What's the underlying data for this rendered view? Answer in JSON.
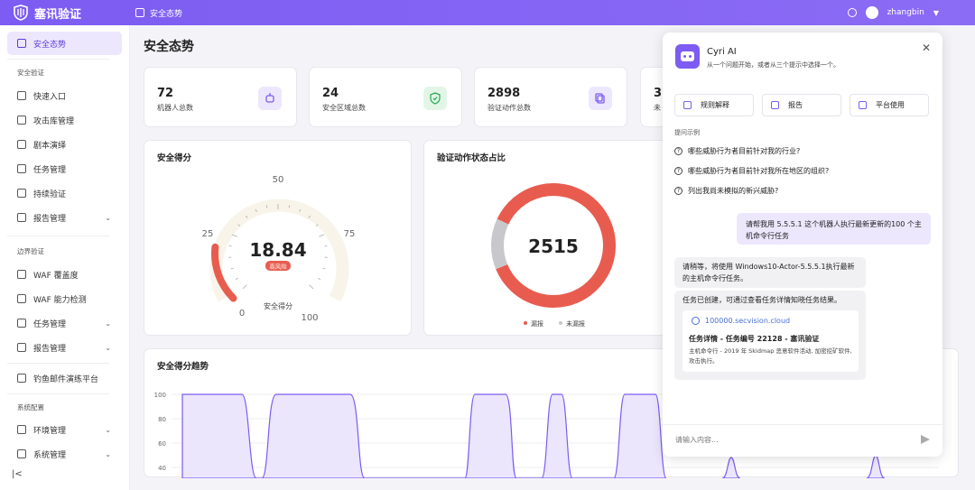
{
  "header": {
    "brand": "塞讯验证",
    "breadcrumb": "安全态势",
    "username": "zhangbin"
  },
  "sidebar": {
    "items_top": [
      {
        "label": "安全态势",
        "icon": "dashboard-icon"
      }
    ],
    "group1": "安全验证",
    "group1_items": [
      {
        "label": "快速入口",
        "icon": "entry-icon"
      },
      {
        "label": "攻击库管理",
        "icon": "attack-lib-icon"
      },
      {
        "label": "剧本演绎",
        "icon": "playbook-icon"
      },
      {
        "label": "任务管理",
        "icon": "task-icon"
      },
      {
        "label": "持续验证",
        "icon": "target-icon"
      },
      {
        "label": "报告管理",
        "icon": "report-icon"
      }
    ],
    "group2": "边界验证",
    "group2_items": [
      {
        "label": "WAF 覆盖度",
        "icon": "shield-icon"
      },
      {
        "label": "WAF 能力检测",
        "icon": "tool-icon"
      },
      {
        "label": "任务管理",
        "icon": "task-icon"
      },
      {
        "label": "报告管理",
        "icon": "report-icon"
      }
    ],
    "phishing": "钓鱼邮件演练平台",
    "group3": "系统配置",
    "group3_items": [
      {
        "label": "环境管理",
        "icon": "env-icon"
      },
      {
        "label": "系统管理",
        "icon": "settings-icon"
      }
    ]
  },
  "main": {
    "title": "安全态势",
    "stats": [
      {
        "value": "72",
        "label": "机器人总数",
        "color": "#ece7fd"
      },
      {
        "value": "24",
        "label": "安全区域总数",
        "color": "#e3f5e7"
      },
      {
        "value": "2898",
        "label": "验证动作总数",
        "color": "#ece7fd"
      },
      {
        "value": "3",
        "label": "未",
        "color": "#ece7fd"
      }
    ],
    "score_card": {
      "title": "安全得分",
      "score": "18.84",
      "risk_badge": "高风险",
      "caption": "安全得分",
      "ticks": [
        "0",
        "25",
        "50",
        "75",
        "100"
      ],
      "value_pct": 18.84
    },
    "donut_card": {
      "title": "验证动作状态占比",
      "center_value": "2515",
      "legend": [
        {
          "label": "漏报",
          "color": "#e85c4f"
        },
        {
          "label": "未漏报",
          "color": "#c8c8cc"
        }
      ]
    },
    "trend_card": {
      "title": "安全得分趋势",
      "y_ticks": [
        "100",
        "80",
        "60",
        "40"
      ]
    }
  },
  "chart_data": {
    "type": "pie",
    "title": "验证动作状态占比",
    "center_label": "2515",
    "slices": [
      {
        "name": "漏报",
        "value": 2515
      },
      {
        "name": "未漏报",
        "value": 383
      }
    ]
  },
  "assistant": {
    "title": "Cyri AI",
    "subtitle": "从一个问题开始，或者从三个提示中选择一个。",
    "chips": [
      "规则解释",
      "报告",
      "平台使用"
    ],
    "hint": "提问示例",
    "questions": [
      "哪些威胁行为者目前针对我的行业?",
      "哪些威胁行为者目前针对我所在地区的组织?",
      "列出我尚未模拟的新兴威胁?"
    ],
    "user_msg": "请帮我用 5.5.5.1 这个机器人执行最新更新的100 个主机命令行任务",
    "bot_msg1": "请稍等，将使用 Windows10-Actor-5.5.5.1执行最新的主机命令行任务。",
    "bot_msg2": "任务已创建，可通过查看任务详情知晓任务结果。",
    "link_url": "100000.secvision.cloud",
    "link_title": "任务详情 - 任务编号 22128 - 塞讯验证",
    "link_desc": "主机命令行 - 2019 年 Skidmap 恶意软件活动, 加密挖矿软件, 攻击执行。",
    "input_placeholder": "请输入内容..."
  }
}
